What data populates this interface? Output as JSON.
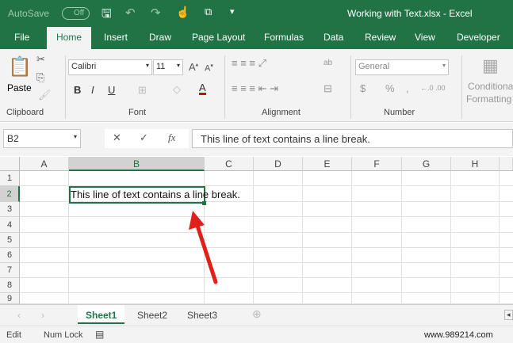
{
  "title_bar": {
    "autosave": "AutoSave",
    "autosave_state": "Off",
    "title": "Working with Text.xlsx  -  Excel"
  },
  "tabs": [
    "File",
    "Home",
    "Insert",
    "Draw",
    "Page Layout",
    "Formulas",
    "Data",
    "Review",
    "View",
    "Developer"
  ],
  "ribbon": {
    "paste": "Paste",
    "font_name": "Calibri",
    "font_size": "11",
    "number_format": "General",
    "conditional": "Conditional",
    "formatting": "Formatting",
    "groups": [
      "Clipboard",
      "Font",
      "Alignment",
      "Number"
    ],
    "bold": "B",
    "italic": "I",
    "underline": "U",
    "font_color_letter": "A",
    "currency": "$",
    "percent": "%",
    "comma": ","
  },
  "formula_bar": {
    "name_box": "B2",
    "fx": "fx",
    "content": "This line of text contains a line break."
  },
  "columns": [
    "A",
    "B",
    "C",
    "D",
    "E",
    "F",
    "G",
    "H"
  ],
  "rows": [
    "1",
    "2",
    "3",
    "4",
    "5",
    "6",
    "7",
    "8",
    "9"
  ],
  "cells": {
    "B2": "This line of text contains a line break."
  },
  "sheets": [
    "Sheet1",
    "Sheet2",
    "Sheet3"
  ],
  "active_sheet": "Sheet1",
  "status": {
    "mode": "Edit",
    "num_lock": "Num Lock"
  },
  "watermark": "www.989214.com",
  "colors": {
    "excel_green": "#217346",
    "arrow": "#e0201b",
    "font_color_bar": "#e00000"
  }
}
